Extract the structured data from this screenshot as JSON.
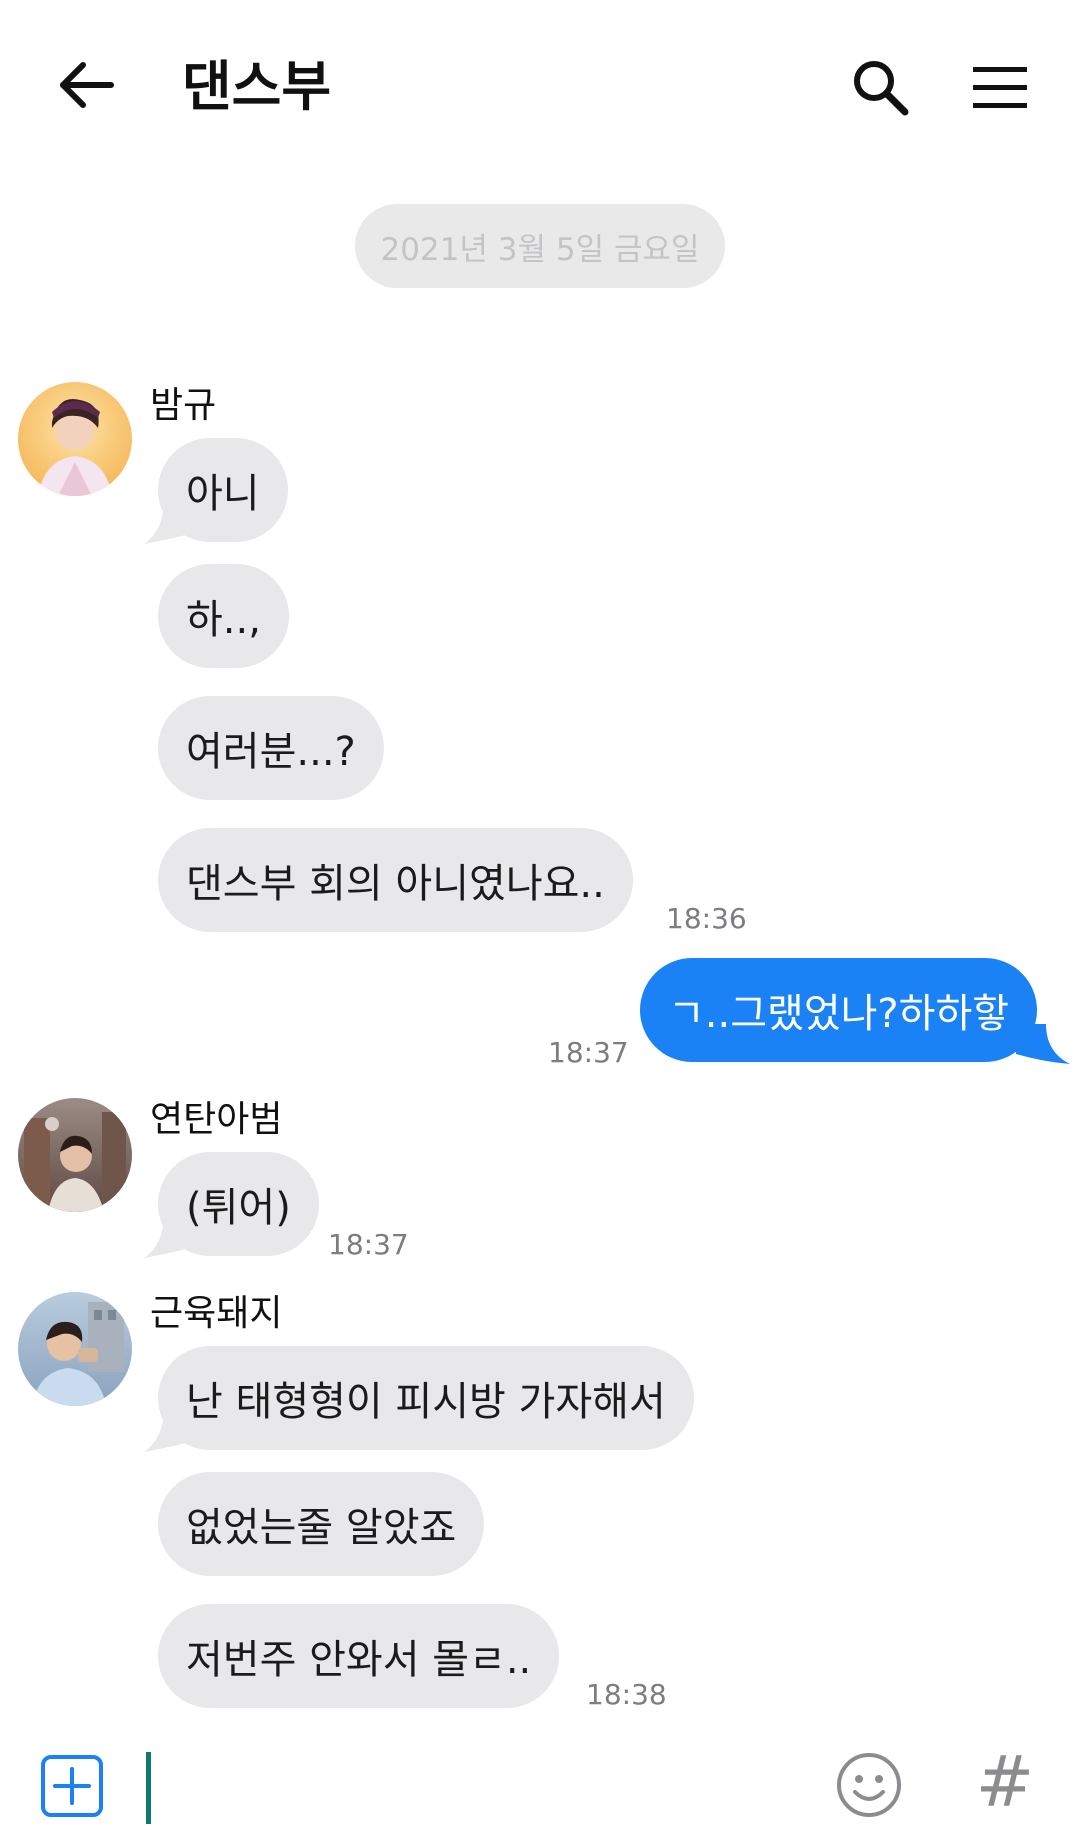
{
  "header": {
    "title": "댄스부",
    "back_icon": "arrow-left-icon",
    "search_icon": "search-icon",
    "menu_icon": "hamburger-menu-icon"
  },
  "date_divider": "2021년 3월 5일 금요일",
  "groups": [
    {
      "sender": "밤규",
      "messages": [
        "아니",
        "하..,",
        "여러분...?",
        "댄스부 회의 아니였나요.."
      ],
      "time": "18:36"
    },
    {
      "sender": "me",
      "messages": [
        "ㄱ..그랬었나?하하핳"
      ],
      "time": "18:37"
    },
    {
      "sender": "연탄아범",
      "messages": [
        "(튀어)"
      ],
      "time": "18:37"
    },
    {
      "sender": "근육돼지",
      "messages": [
        "난 태형형이 피시방 가자해서",
        "없었는줄 알았죠",
        "저번주 안와서 몰ㄹ.."
      ],
      "time": "18:38"
    }
  ],
  "input_bar": {
    "value": "",
    "plus_icon": "plus-square-icon",
    "emoji_icon": "smiley-icon",
    "hash_label": "#"
  },
  "colors": {
    "my_bubble": "#1a82f4",
    "other_bubble": "#e8e8ea",
    "caret": "#0d7a6b",
    "plus_icon": "#1a82f4"
  }
}
